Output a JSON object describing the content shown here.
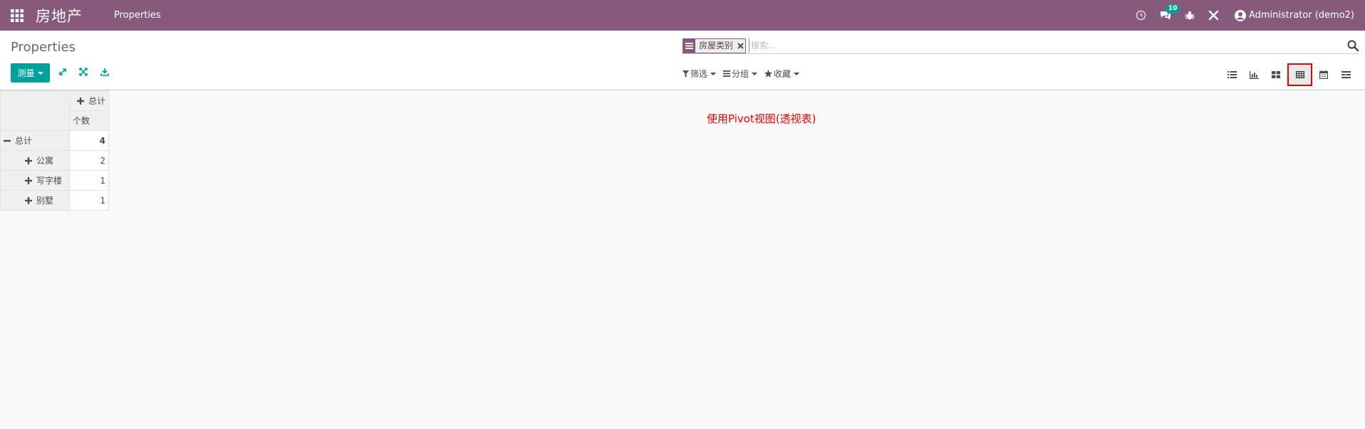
{
  "navbar": {
    "brand": "房地产",
    "menu": [
      "Properties"
    ],
    "notification_count": "10",
    "user": "Administrator (demo2)",
    "bg_color": "#875a7b"
  },
  "control_panel": {
    "breadcrumb": "Properties",
    "measure_label": "测量",
    "search": {
      "facet_value": "房屋类别",
      "placeholder": "搜索..."
    },
    "filters": {
      "filter_label": "筛选",
      "groupby_label": "分组",
      "favorites_label": "收藏"
    },
    "views": [
      "list-icon",
      "graph-icon",
      "kanban-icon",
      "pivot-icon",
      "calendar-icon",
      "activity-icon"
    ],
    "active_view": "pivot-icon"
  },
  "pivot": {
    "col_header": "总计",
    "measure_header": "个数",
    "total_row": {
      "label": "总计",
      "value": "4"
    },
    "rows": [
      {
        "label": "公寓",
        "value": "2"
      },
      {
        "label": "写字楼",
        "value": "1"
      },
      {
        "label": "别墅",
        "value": "1"
      }
    ]
  },
  "annotation": "使用Pivot视图(透视表)"
}
